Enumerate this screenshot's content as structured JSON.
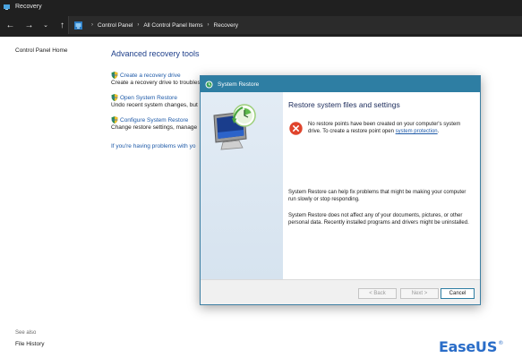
{
  "window": {
    "title": "Recovery"
  },
  "address_bar": {
    "breadcrumbs": [
      "Control Panel",
      "All Control Panel Items",
      "Recovery"
    ]
  },
  "left_pane": {
    "home_link": "Control Panel Home",
    "see_also_heading": "See also",
    "file_history_link": "File History"
  },
  "main": {
    "heading": "Advanced recovery tools",
    "tools": [
      {
        "label": "Create a recovery drive",
        "description": "Create a recovery drive to troubles"
      },
      {
        "label": "Open System Restore",
        "description": "Undo recent system changes, but"
      },
      {
        "label": "Configure System Restore",
        "description": "Change restore settings, manage"
      }
    ],
    "problems_link": "If you're having problems with yo"
  },
  "dialog": {
    "title": "System Restore",
    "heading": "Restore system files and settings",
    "error_text": "No restore points have been created on your computer's system drive. To create a restore point open ",
    "error_link": "system protection",
    "error_suffix": ".",
    "paragraph1": "System Restore can help fix problems that might be making your computer run slowly or stop responding.",
    "paragraph2": "System Restore does not affect any of your documents, pictures, or other personal data. Recently installed programs and drivers might be uninstalled.",
    "buttons": {
      "back": "< Back",
      "next": "Next >",
      "cancel": "Cancel"
    }
  },
  "watermark": {
    "text_ease": "Ease",
    "text_us": "US",
    "registered": "®"
  },
  "colors": {
    "titlebar_bg": "#202020",
    "link": "#1e5aa8",
    "heading": "#1e3f8a",
    "dialog_title_bg": "#2e7ea3",
    "error_red": "#e0442c",
    "watermark_blue": "#2a6dc8"
  },
  "icons": {
    "window": "recovery-app-icon",
    "back": "arrow-left-icon",
    "forward": "arrow-right-icon",
    "recent": "chevron-down-icon",
    "up": "arrow-up-icon",
    "control_panel": "control-panel-icon",
    "shield": "uac-shield-icon",
    "dialog": "system-restore-icon",
    "error": "error-x-icon"
  }
}
